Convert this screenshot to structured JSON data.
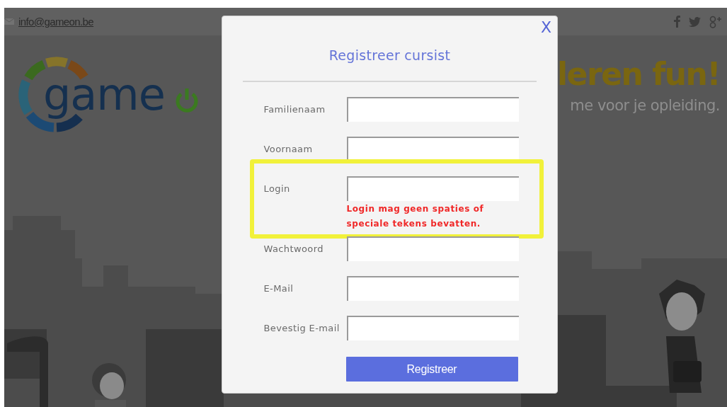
{
  "top_bar": {
    "email": "info@gameon.be"
  },
  "hero": {
    "logo_text": "game",
    "headline": "leren fun!",
    "subtitle": "me voor je opleiding."
  },
  "dialog": {
    "close": "X",
    "title": "Registreer cursist",
    "fields": [
      {
        "label": "Familienaam",
        "highlighted": false
      },
      {
        "label": "Voornaam",
        "highlighted": false
      },
      {
        "label": "Login",
        "highlighted": true,
        "error": "Login mag geen spaties of speciale tekens bevatten."
      },
      {
        "label": "Wachtwoord",
        "highlighted": false
      },
      {
        "label": "E-Mail",
        "highlighted": false
      },
      {
        "label": "Bevestig E-mail",
        "highlighted": false
      }
    ],
    "submit": "Registreer"
  }
}
